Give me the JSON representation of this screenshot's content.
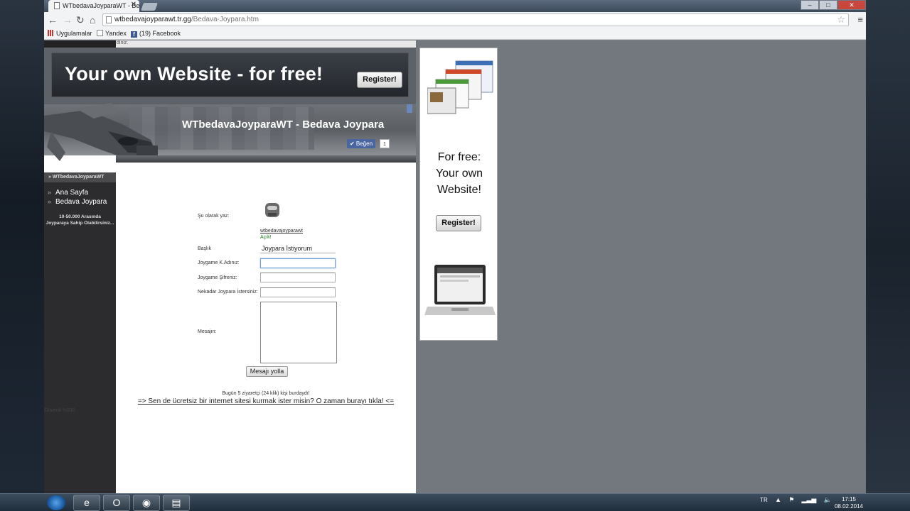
{
  "browser": {
    "tab_title": "WTbedavaJoyparaWT - Be",
    "url_host": "wtbedavajoyparawt.tr.gg",
    "url_path": "/Bedava-Joypara.htm",
    "bookmarks": [
      {
        "label": "Uygulamalar",
        "icon": "apps-icon"
      },
      {
        "label": "Yandex",
        "icon": "page-icon"
      },
      {
        "label": "(19) Facebook",
        "icon": "facebook-icon"
      }
    ]
  },
  "page": {
    "top_strip_text": "diniz.",
    "banner": {
      "text": "Your own Website - for free!",
      "button": "Register!"
    },
    "site_title": "WTbedavaJoyparaWT - Bedava Joypara",
    "like_label": "Beğen",
    "like_count": "1",
    "sidebar": {
      "title": "» WTbedavaJoyparaWT",
      "items": [
        "Ana Sayfa",
        "Bedava Joypara"
      ],
      "note_line1": "10-50.000 Arasında",
      "note_line2": "Joyparaya Sahip Olabilirsiniz..."
    },
    "form": {
      "write_as_label": "Şu olarak yaz:",
      "username": "wtbedavajoyparawt",
      "open_label": "Açık!",
      "subject_label": "Başlık",
      "subject_value": "Joypara İstiyorum",
      "joygame_user_label": "Joygame K.Adınız:",
      "joygame_user_value": "",
      "joygame_pass_label": "Joygame Şifreniz:",
      "joygame_pass_value": "",
      "amount_label": "Nekadar Joypara İstersiniz:",
      "amount_value": "",
      "message_label": "Mesajın:",
      "send_button": "Mesajı yolla"
    },
    "visitors": "Bugün 5 ziyaretçi (24 klik) kişi burdaydı!",
    "promo_link": "=> Sen de ücretsiz bir internet sitesi kurmak ister misin? O zaman burayı tıkla! <=",
    "secure_text": "Güvenli %100"
  },
  "side_ad": {
    "line1": "For free:",
    "line2": "Your own",
    "line3": "Website!",
    "button": "Register!"
  },
  "taskbar": {
    "lang": "TR",
    "time": "17:15",
    "date": "08.02.2014"
  }
}
